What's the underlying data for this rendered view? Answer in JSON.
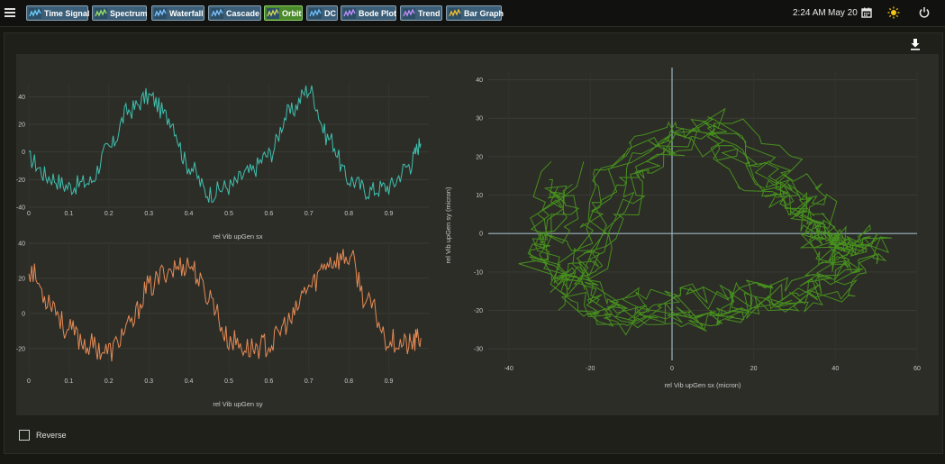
{
  "nav": {
    "buttons": [
      {
        "label": "Time Signal",
        "icon": "time-signal-icon",
        "active": false
      },
      {
        "label": "Spectrum",
        "icon": "spectrum-icon",
        "active": false
      },
      {
        "label": "Waterfall",
        "icon": "waterfall-icon",
        "active": false
      },
      {
        "label": "Cascade",
        "icon": "cascade-icon",
        "active": false
      },
      {
        "label": "Orbit",
        "icon": "orbit-icon",
        "active": true
      },
      {
        "label": "DC",
        "icon": "dc-icon",
        "active": false
      },
      {
        "label": "Bode Plot",
        "icon": "bode-plot-icon",
        "active": false
      },
      {
        "label": "Trend",
        "icon": "trend-icon",
        "active": false
      },
      {
        "label": "Bar Graph",
        "icon": "bar-graph-icon",
        "active": false
      }
    ],
    "time": "2:24 AM",
    "date": "May 20"
  },
  "controls": {
    "reverse_label": "Reverse",
    "reverse_checked": false
  },
  "chart_data": [
    {
      "type": "line",
      "xlabel": "rel Vib upGen sx",
      "color": "#3fbfae",
      "xlim": [
        0,
        1
      ],
      "ylim": [
        -40,
        50
      ],
      "x_ticks": [
        "0",
        "0.1",
        "0.2",
        "0.3",
        "0.4",
        "0.5",
        "0.6",
        "0.7",
        "0.8",
        "0.9"
      ],
      "y_ticks": [
        "40",
        "20",
        "0",
        "-20",
        "-40"
      ],
      "x": [
        0,
        0.05,
        0.1,
        0.15,
        0.2,
        0.25,
        0.3,
        0.35,
        0.4,
        0.45,
        0.5,
        0.55,
        0.6,
        0.65,
        0.7,
        0.75,
        0.8,
        0.85,
        0.9,
        0.95,
        0.98
      ],
      "y": [
        -5,
        -18,
        -25,
        -22,
        2,
        30,
        40,
        25,
        -10,
        -30,
        -25,
        -15,
        -2,
        28,
        45,
        10,
        -20,
        -28,
        -25,
        -10,
        6
      ]
    },
    {
      "type": "line",
      "xlabel": "rel Vib upGen sy",
      "color": "#e58a55",
      "xlim": [
        0,
        1
      ],
      "ylim": [
        -35,
        40
      ],
      "x_ticks": [
        "0",
        "0.1",
        "0.2",
        "0.3",
        "0.4",
        "0.5",
        "0.6",
        "0.7",
        "0.8",
        "0.9"
      ],
      "y_ticks": [
        "40",
        "20",
        "0",
        "-20"
      ],
      "x": [
        0,
        0.05,
        0.1,
        0.15,
        0.2,
        0.25,
        0.3,
        0.35,
        0.4,
        0.45,
        0.5,
        0.55,
        0.6,
        0.65,
        0.7,
        0.75,
        0.8,
        0.85,
        0.9,
        0.95,
        0.98
      ],
      "y": [
        25,
        8,
        -10,
        -18,
        -22,
        -8,
        15,
        25,
        28,
        10,
        -15,
        -20,
        -18,
        -5,
        15,
        30,
        32,
        5,
        -15,
        -18,
        -14
      ]
    },
    {
      "type": "scatter",
      "xlabel": "rel Vib upGen sx (micron)",
      "ylabel": "rel Vib upGen sy (micron)",
      "color": "#4a9a1e",
      "xlim": [
        -45,
        60
      ],
      "ylim": [
        -33,
        42
      ],
      "x_ticks": [
        "-40",
        "-20",
        "0",
        "20",
        "40",
        "60"
      ],
      "y_ticks": [
        "40",
        "30",
        "20",
        "10",
        "0",
        "-10",
        "-20",
        "-30"
      ],
      "x": [
        -25,
        -20,
        -15,
        -5,
        5,
        15,
        25,
        30,
        35,
        40,
        45,
        42,
        38,
        30,
        20,
        10,
        0,
        -10,
        -20,
        -28,
        -30,
        -25
      ],
      "y": [
        -15,
        -5,
        10,
        22,
        28,
        25,
        15,
        10,
        5,
        0,
        0,
        -5,
        -10,
        -15,
        -18,
        -20,
        -18,
        -20,
        -18,
        -10,
        5,
        15
      ]
    }
  ]
}
